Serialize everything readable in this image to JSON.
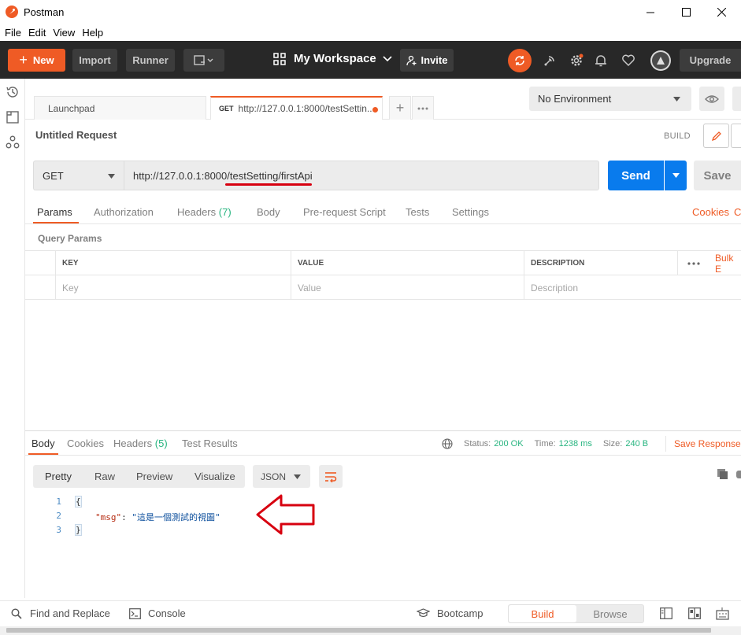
{
  "window": {
    "title": "Postman"
  },
  "menu": [
    "File",
    "Edit",
    "View",
    "Help"
  ],
  "header": {
    "new_label": "New",
    "import_label": "Import",
    "runner_label": "Runner",
    "workspace_label": "My Workspace",
    "invite_label": "Invite",
    "upgrade_label": "Upgrade"
  },
  "tabs": {
    "launchpad": "Launchpad",
    "request_method": "GET",
    "request_label": "http://127.0.0.1:8000/testSettin..."
  },
  "environment": {
    "selected": "No Environment"
  },
  "request": {
    "title": "Untitled Request",
    "build_label": "BUILD",
    "method": "GET",
    "url_base": "http://127.0.0.1:8000/",
    "url_path": "testSetting/firstApi",
    "send_label": "Send",
    "save_label": "Save"
  },
  "request_tabs": {
    "params": "Params",
    "authorization": "Authorization",
    "headers": "Headers",
    "headers_count": "(7)",
    "body": "Body",
    "prerequest": "Pre-request Script",
    "tests": "Tests",
    "settings": "Settings",
    "cookies": "Cookies",
    "code": "C"
  },
  "query_params": {
    "title": "Query Params",
    "columns": [
      "KEY",
      "VALUE",
      "DESCRIPTION"
    ],
    "placeholders": [
      "Key",
      "Value",
      "Description"
    ],
    "bulk_edit": "Bulk E"
  },
  "response": {
    "tabs": {
      "body": "Body",
      "cookies": "Cookies",
      "headers": "Headers",
      "headers_count": "(5)",
      "test_results": "Test Results"
    },
    "status_label": "Status:",
    "status_value": "200 OK",
    "time_label": "Time:",
    "time_value": "1238 ms",
    "size_label": "Size:",
    "size_value": "240 B",
    "save_response": "Save Response",
    "view_tabs": [
      "Pretty",
      "Raw",
      "Preview",
      "Visualize"
    ],
    "format": "JSON",
    "lines": [
      {
        "n": "1",
        "text": "{"
      },
      {
        "n": "2",
        "key": "\"msg\"",
        "sep": ": ",
        "value": "\"這是一個測試的視圖\""
      },
      {
        "n": "3",
        "text": "}"
      }
    ]
  },
  "footer": {
    "find_replace": "Find and Replace",
    "console": "Console",
    "bootcamp": "Bootcamp",
    "build": "Build",
    "browse": "Browse"
  },
  "colors": {
    "accent": "#ef5b25",
    "send": "#097bed",
    "success": "#26b47f",
    "annotation": "#d7000f"
  }
}
